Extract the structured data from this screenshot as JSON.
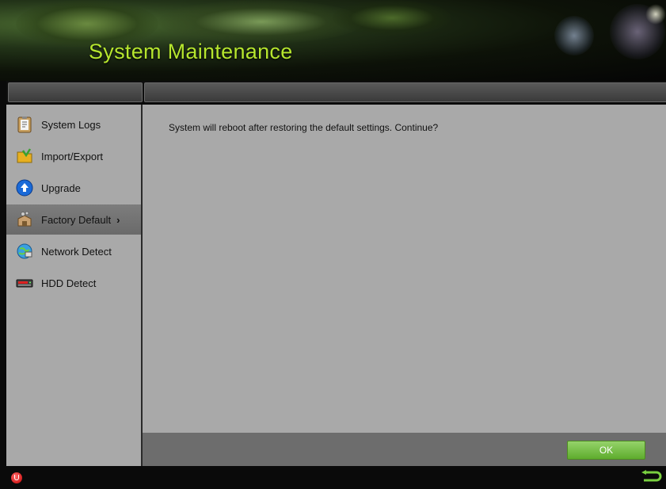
{
  "header": {
    "title": "System Maintenance"
  },
  "sidebar": {
    "items": [
      {
        "label": "System Logs",
        "icon": "clipboard-icon"
      },
      {
        "label": "Import/Export",
        "icon": "folder-icon"
      },
      {
        "label": "Upgrade",
        "icon": "upgrade-arrow-icon"
      },
      {
        "label": "Factory Default",
        "icon": "factory-icon",
        "active": true,
        "chevron": "›"
      },
      {
        "label": "Network Detect",
        "icon": "globe-network-icon"
      },
      {
        "label": "HDD Detect",
        "icon": "hdd-icon"
      }
    ]
  },
  "main": {
    "message": "System will reboot after restoring the default settings. Continue?",
    "ok_label": "OK"
  },
  "colors": {
    "title": "#b6e62e",
    "ok_button": "#6bbc3a",
    "panel": "#a9a9a9"
  }
}
